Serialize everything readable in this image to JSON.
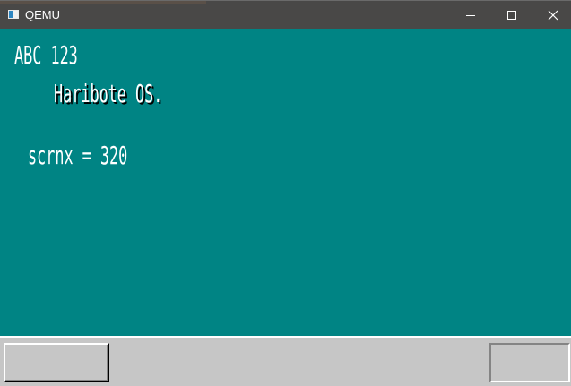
{
  "window": {
    "title": "QEMU",
    "controls": {
      "minimize_icon": "minimize-icon",
      "maximize_icon": "maximize-icon",
      "close_glyph": "✕"
    }
  },
  "screen": {
    "background": "#008484",
    "text_color": "#ffffff",
    "shadow_color": "#000000",
    "lines": [
      "ABC 123",
      "Haribote OS.",
      "scrnx = 320"
    ]
  },
  "taskbar": {
    "background": "#c6c6c6"
  }
}
